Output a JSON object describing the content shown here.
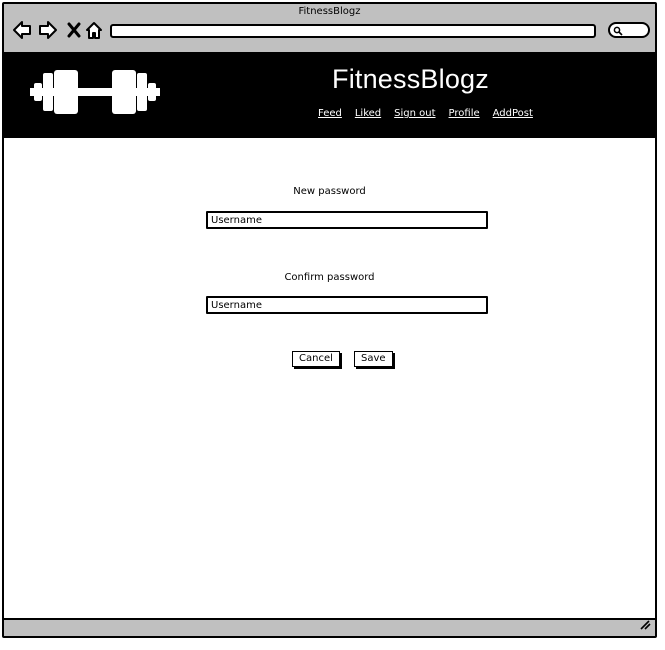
{
  "browser": {
    "window_title": "FitnessBlogz",
    "icons": [
      "back-arrow-icon",
      "forward-arrow-icon",
      "close-x-icon",
      "home-icon",
      "search-icon",
      "resize-grip-icon"
    ]
  },
  "header": {
    "brand": "FitnessBlogz",
    "logo_icon": "dumbbell-icon",
    "nav": [
      "Feed",
      "Liked",
      "Sign out",
      "Profile",
      "AddPost"
    ]
  },
  "form": {
    "new_password_label": "New password",
    "new_password_value": "Username",
    "confirm_password_label": "Confirm password",
    "confirm_password_value": "Username",
    "cancel_label": "Cancel",
    "save_label": "Save"
  },
  "colors": {
    "header_bg": "#000000",
    "chrome_bg": "#c0c0c0",
    "page_bg": "#ffffff"
  }
}
